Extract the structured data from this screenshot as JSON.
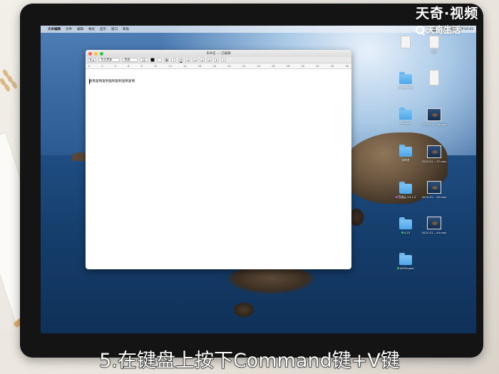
{
  "menubar": {
    "apple": "",
    "items": [
      "文本编辑",
      "文件",
      "编辑",
      "格式",
      "显示",
      "窗口",
      "帮助"
    ],
    "battery": "92%",
    "clock": "周五 上午10:43"
  },
  "window": {
    "title": "未命名 — 已编辑",
    "toolbar": {
      "paragraph_style": "¶ a",
      "font_family": "华文黑体",
      "font_style": "常规",
      "font_size": "12"
    },
    "ruler_ticks": [
      "0",
      "2",
      "4",
      "6",
      "8",
      "10",
      "12",
      "14",
      "16",
      "18",
      "20",
      "22",
      "24",
      "26",
      "28",
      "30",
      "32",
      "34",
      "36"
    ],
    "document_text": "复制复制复制复制复制复制复制"
  },
  "desktop": {
    "icons": [
      {
        "label": "",
        "kind": "doc"
      },
      {
        "label": "文件",
        "kind": "doc"
      },
      {
        "label": "Screenshot",
        "kind": "folder"
      },
      {
        "label": "",
        "kind": "doc"
      },
      {
        "label": "Package",
        "kind": "folder"
      },
      {
        "label": "2022-01....48.mov",
        "kind": "thumb"
      },
      {
        "label": "未命名",
        "kind": "folder"
      },
      {
        "label": "2022-01....37.mov",
        "kind": "thumb"
      },
      {
        "label": "百度云 V4.1.5",
        "kind": "folder",
        "tag": "#b25de0"
      },
      {
        "label": "2022-01....30.mov",
        "kind": "thumb"
      },
      {
        "label": "4.15",
        "kind": "folder",
        "tag": "#3cc45a"
      },
      {
        "label": "2022-01....44.mov",
        "kind": "thumb"
      },
      {
        "label": "JDSProject",
        "kind": "folder",
        "tag": "#3cc45a"
      }
    ]
  },
  "watermark": {
    "main": "天奇·视频",
    "sub": "天奇生活"
  },
  "subtitle": "5.在键盘上按下Command键+V键"
}
